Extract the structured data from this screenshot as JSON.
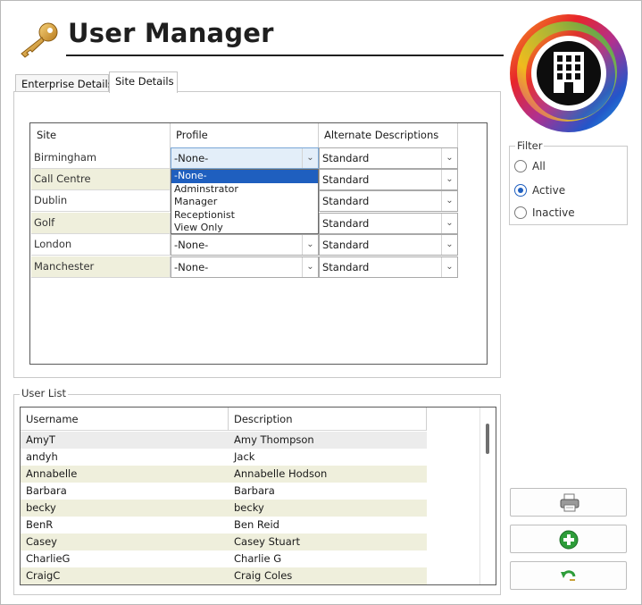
{
  "app": {
    "title": "User Manager"
  },
  "tabs": [
    {
      "label": "Enterprise Details"
    },
    {
      "label": "Site Details",
      "active": true
    }
  ],
  "site_grid": {
    "headers": {
      "site": "Site",
      "profile": "Profile",
      "alt": "Alternate Descriptions"
    },
    "rows": [
      {
        "site": "Birmingham",
        "profile": "-None-",
        "alt": "Standard"
      },
      {
        "site": "Call Centre",
        "profile": "-None-",
        "alt": "Standard"
      },
      {
        "site": "Dublin",
        "profile": "-None-",
        "alt": "Standard"
      },
      {
        "site": "Golf",
        "profile": "-None-",
        "alt": "Standard"
      },
      {
        "site": "London",
        "profile": "-None-",
        "alt": "Standard"
      },
      {
        "site": "Manchester",
        "profile": "-None-",
        "alt": "Standard"
      }
    ],
    "dropdown_options": [
      "-None-",
      "Adminstrator",
      "Manager",
      "Receptionist",
      "View Only"
    ],
    "dropdown_selected": "-None-"
  },
  "filter": {
    "legend": "Filter",
    "options": [
      "All",
      "Active",
      "Inactive"
    ],
    "selected": "Active"
  },
  "user_list": {
    "legend": "User List",
    "headers": {
      "username": "Username",
      "description": "Description"
    },
    "rows": [
      {
        "username": "AmyT",
        "description": "Amy Thompson"
      },
      {
        "username": "andyh",
        "description": "Jack"
      },
      {
        "username": "Annabelle",
        "description": "Annabelle Hodson"
      },
      {
        "username": "Barbara",
        "description": "Barbara"
      },
      {
        "username": "becky",
        "description": "becky"
      },
      {
        "username": "BenR",
        "description": "Ben Reid"
      },
      {
        "username": "Casey",
        "description": "Casey Stuart"
      },
      {
        "username": "CharlieG",
        "description": "Charlie G"
      },
      {
        "username": "CraigC",
        "description": "Craig Coles"
      }
    ]
  },
  "actions": {
    "icons": [
      "printer-icon",
      "add-icon",
      "undo-icon"
    ]
  },
  "colors": {
    "alt_row": "#efefdc",
    "selection": "#1f5fbf",
    "add_green": "#2e9d3a"
  }
}
